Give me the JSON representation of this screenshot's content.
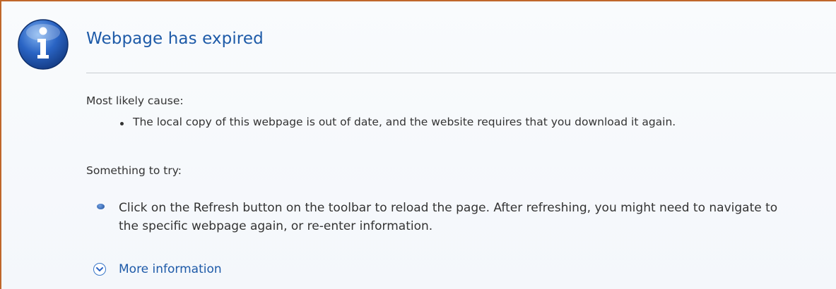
{
  "page": {
    "title": "Webpage has expired",
    "cause_label": "Most likely cause:",
    "cause_items": [
      "The local copy of this webpage is out of date, and the website requires that you download it again."
    ],
    "try_label": "Something to try:",
    "try_items": [
      "Click on the Refresh button on the toolbar to reload the page. After refreshing, you might need to navigate to the specific webpage again, or re-enter information."
    ],
    "more_info_label": "More information"
  },
  "icons": {
    "header": "info-icon",
    "expand": "chevron-down-icon"
  },
  "colors": {
    "title": "#1d5aa8",
    "frame_border": "#c0672a",
    "text": "#333333",
    "link": "#1d5aa8"
  }
}
